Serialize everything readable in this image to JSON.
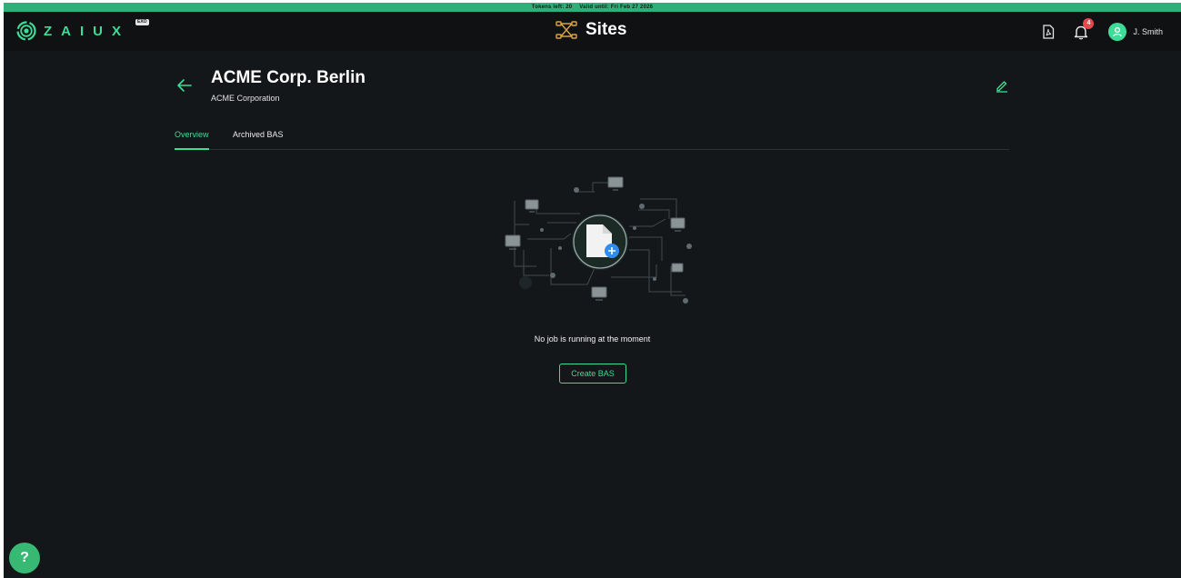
{
  "token_bar": {
    "tokens": "Tokens left: 20",
    "valid": "Valid until: Fri Feb 27 2026"
  },
  "appbar": {
    "logo_text": "ZAIUX",
    "logo_badge": "EXO",
    "title": "Sites",
    "title_icon": "network-icon",
    "pdf_icon": "pdf-icon",
    "bell_icon": "bell-icon",
    "notification_count": "4",
    "user_name": "J. Smith"
  },
  "site": {
    "title": "ACME Corp. Berlin",
    "subtitle": "ACME Corporation"
  },
  "tabs": [
    {
      "label": "Overview",
      "active": true
    },
    {
      "label": "Archived BAS",
      "active": false
    }
  ],
  "empty_state": {
    "message": "No job is running at the moment",
    "button_label": "Create BAS"
  },
  "help": {
    "label": "?"
  },
  "colors": {
    "accent": "#3ddc97",
    "token_bar": "#2fb07a",
    "background": "#141719",
    "appbar": "#0f1113",
    "badge": "#e5484d",
    "title_icon": "#d9a441",
    "plus_badge": "#2f8cf0"
  }
}
